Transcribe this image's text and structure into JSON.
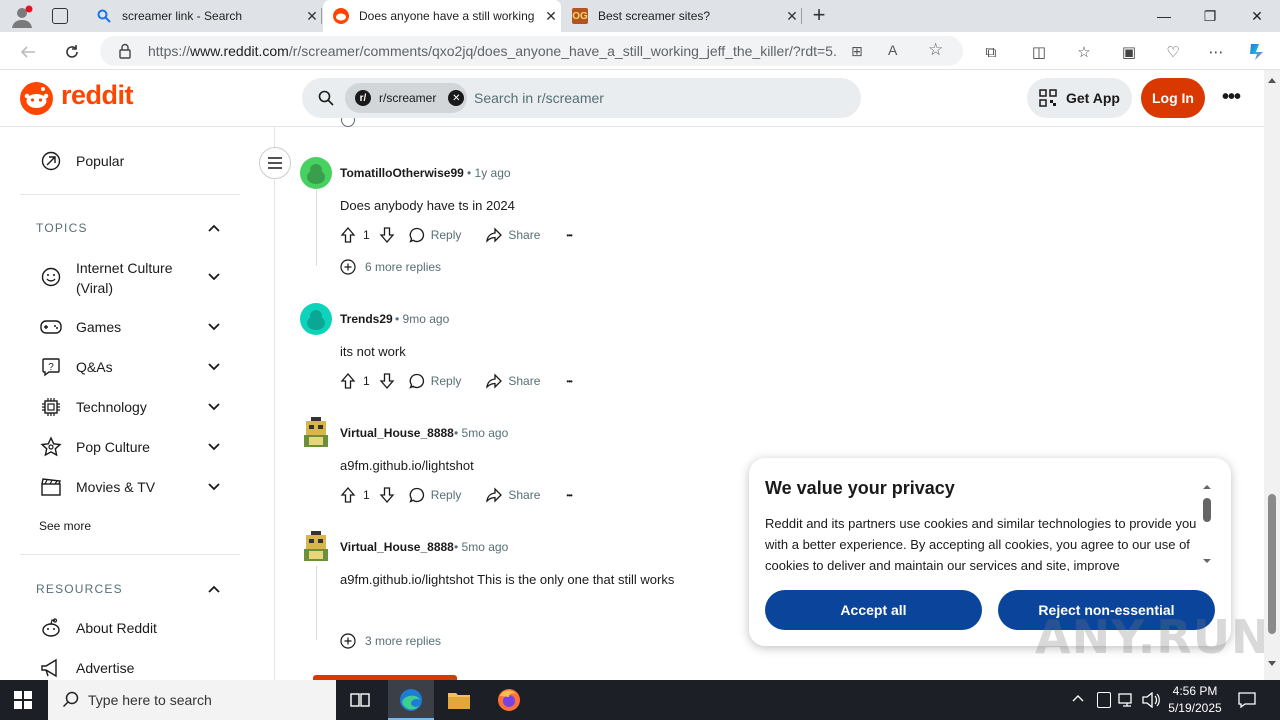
{
  "browser": {
    "tabs": [
      {
        "title": "screamer link - Search",
        "active": false
      },
      {
        "title": "Does anyone have a still working",
        "active": true
      },
      {
        "title": "Best screamer sites?",
        "active": false
      }
    ],
    "url_prefix": "https://",
    "url_domain": "www.reddit.com",
    "url_path": "/r/screamer/comments/qxo2jq/does_anyone_have_a_still_working_jeff_the_killer/?rdt=5..."
  },
  "header": {
    "logo_text": "reddit",
    "search_chip": "r/screamer",
    "search_placeholder": "Search in r/screamer",
    "get_app": "Get App",
    "login": "Log In"
  },
  "sidebar": {
    "popular": "Popular",
    "topics_heading": "TOPICS",
    "topics": [
      {
        "label": "Internet Culture\n(Viral)",
        "icon": "smile-icon"
      },
      {
        "label": "Games",
        "icon": "gamepad-icon"
      },
      {
        "label": "Q&As",
        "icon": "question-icon"
      },
      {
        "label": "Technology",
        "icon": "chip-icon"
      },
      {
        "label": "Pop Culture",
        "icon": "star-icon"
      },
      {
        "label": "Movies & TV",
        "icon": "clapper-icon"
      }
    ],
    "see_more": "See more",
    "resources_heading": "RESOURCES",
    "resources": [
      {
        "label": "About Reddit",
        "icon": "reddit-alien-icon"
      },
      {
        "label": "Advertise",
        "icon": "megaphone-icon"
      }
    ]
  },
  "comments": [
    {
      "user": "TomatilloOtherwise99",
      "time": "1y ago",
      "text": "Does anybody have ts in 2024",
      "votes": "1",
      "more": "6 more replies",
      "avatar_color": "#46d160"
    },
    {
      "user": "Trends29",
      "time": "9mo ago",
      "text": "its not work",
      "votes": "1",
      "avatar_color": "#0dd3bb"
    },
    {
      "user": "Virtual_House_8888",
      "time": "5mo ago",
      "text": "a9fm.github.io/lightshot",
      "votes": "1"
    },
    {
      "user": "Virtual_House_8888",
      "time": "5mo ago",
      "text": "a9fm.github.io/lightshot This is the only one that still works",
      "more": "3 more replies"
    }
  ],
  "actions": {
    "reply": "Reply",
    "share": "Share",
    "dots": "•••",
    "sep": "•"
  },
  "privacy": {
    "title": "We value your privacy",
    "text": "Reddit and its partners use cookies and similar technologies to provide you with a better experience. By accepting all cookies, you agree to our use of cookies to deliver and maintain our services and site, improve",
    "accept": "Accept all",
    "reject": "Reject non-essential"
  },
  "taskbar": {
    "search_placeholder": "Type here to search",
    "time": "4:56 PM",
    "date": "5/19/2025"
  },
  "watermark": "ANY.RUN"
}
